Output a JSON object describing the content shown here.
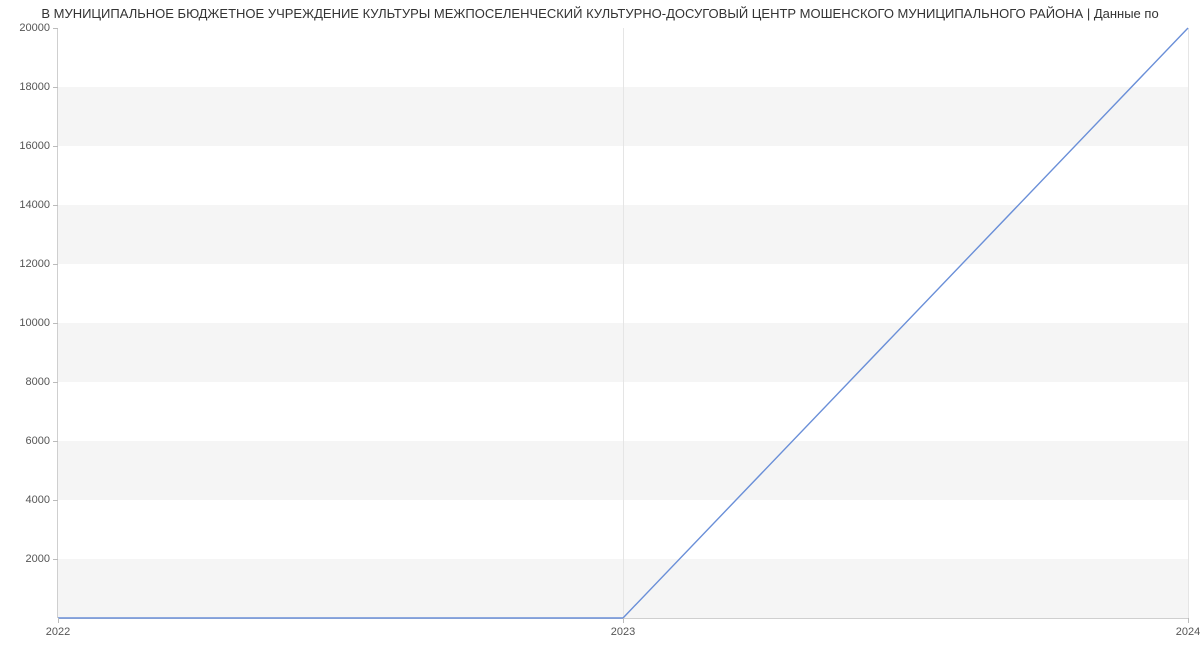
{
  "chart_data": {
    "type": "line",
    "title": "В МУНИЦИПАЛЬНОЕ БЮДЖЕТНОЕ УЧРЕЖДЕНИЕ КУЛЬТУРЫ МЕЖПОСЕЛЕНЧЕСКИЙ КУЛЬТУРНО-ДОСУГОВЫЙ ЦЕНТР МОШЕНСКОГО МУНИЦИПАЛЬНОГО РАЙОНА | Данные по",
    "x": [
      2022,
      2023,
      2024
    ],
    "values": [
      0,
      0,
      20000
    ],
    "xlabel": "",
    "ylabel": "",
    "xlim": [
      2022,
      2024
    ],
    "ylim": [
      0,
      20000
    ],
    "y_ticks": [
      2000,
      4000,
      6000,
      8000,
      10000,
      12000,
      14000,
      16000,
      18000,
      20000
    ],
    "x_ticks": [
      2022,
      2023,
      2024
    ],
    "line_color": "#6a8fd8"
  }
}
